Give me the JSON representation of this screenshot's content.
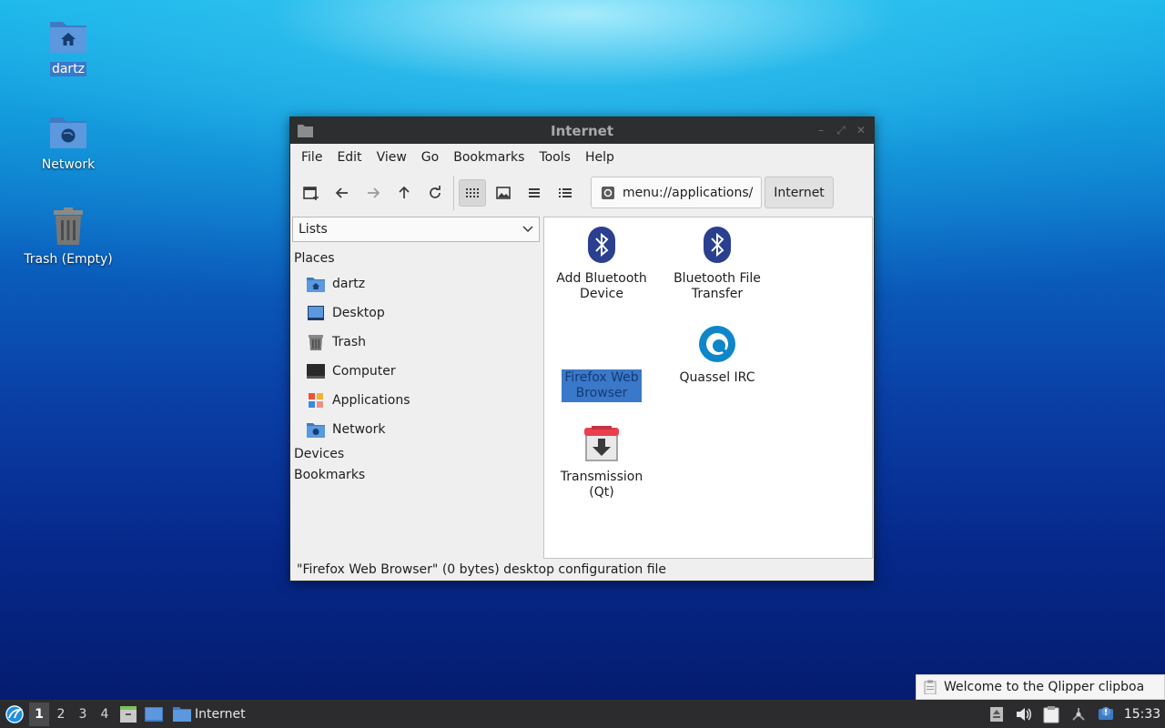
{
  "desktop": {
    "icons": [
      {
        "label": "dartz"
      },
      {
        "label": "Network"
      },
      {
        "label": "Trash (Empty)"
      }
    ]
  },
  "window": {
    "title": "Internet",
    "menu": [
      "File",
      "Edit",
      "View",
      "Go",
      "Bookmarks",
      "Tools",
      "Help"
    ],
    "path": "menu://applications/",
    "breadcrumb": "Internet",
    "sidebar": {
      "mode": "Lists",
      "places_heading": "Places",
      "places": [
        {
          "label": "dartz",
          "icon": "home-folder-icon"
        },
        {
          "label": "Desktop",
          "icon": "desktop-icon"
        },
        {
          "label": "Trash",
          "icon": "trash-icon"
        },
        {
          "label": "Computer",
          "icon": "computer-icon"
        },
        {
          "label": "Applications",
          "icon": "applications-icon"
        },
        {
          "label": "Network",
          "icon": "network-folder-icon"
        }
      ],
      "devices_heading": "Devices",
      "bookmarks_heading": "Bookmarks"
    },
    "apps": [
      {
        "label": "Add Bluetooth Device",
        "icon": "bluetooth-icon"
      },
      {
        "label": "Bluetooth File Transfer",
        "icon": "bluetooth-icon"
      },
      {
        "label": "Firefox Web Browser",
        "icon": "firefox-icon"
      },
      {
        "label": "Quassel IRC",
        "icon": "quassel-icon"
      },
      {
        "label": "Transmission (Qt)",
        "icon": "transmission-icon"
      }
    ],
    "status": "\"Firefox Web Browser\" (0 bytes) desktop configuration file"
  },
  "notification": {
    "text": "Welcome to the Qlipper clipboa"
  },
  "taskbar": {
    "workspaces": [
      "1",
      "2",
      "3",
      "4"
    ],
    "active_workspace": "1",
    "task_label": "Internet",
    "clock": "15:33"
  },
  "colors": {
    "selection": "#3a78c9",
    "folder": "#4a86d0",
    "bluetooth": "#2a3f8f",
    "taskbar": "#2c2c2e"
  }
}
